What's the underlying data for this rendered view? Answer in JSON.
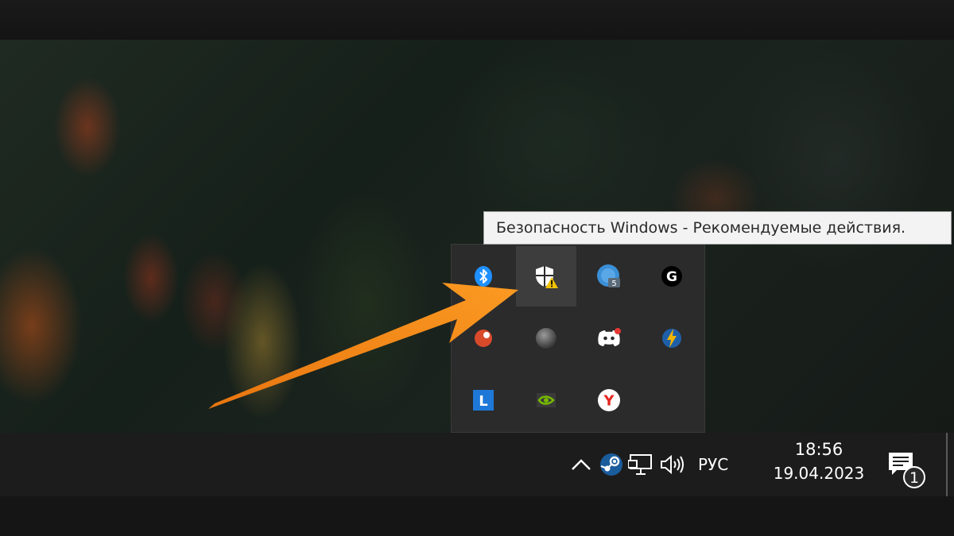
{
  "tooltip": {
    "text": "Безопасность Windows - Рекомендуемые действия."
  },
  "overflow_icons": [
    {
      "name": "bluetooth-icon",
      "color": "#1e90ff"
    },
    {
      "name": "windows-security-warning-icon",
      "color": "#f2c200",
      "hovered": true
    },
    {
      "name": "updater-icon",
      "badge": "5",
      "color": "#3b8fd6"
    },
    {
      "name": "logitech-g-icon",
      "label": "G",
      "color": "#ffffff"
    },
    {
      "name": "red-app-icon",
      "color": "#d94a2b"
    },
    {
      "name": "gray-orb-icon",
      "color": "#6d6d6d"
    },
    {
      "name": "discord-icon",
      "color": "#ffffff"
    },
    {
      "name": "lightning-app-icon",
      "color": "#f2b600"
    },
    {
      "name": "lingvo-l-icon",
      "label": "L",
      "color": "#1e78d8"
    },
    {
      "name": "nvidia-icon",
      "color": "#76b900"
    },
    {
      "name": "yandex-browser-icon",
      "label": "Y",
      "color": "#e52620"
    }
  ],
  "tray": {
    "language": "РУС",
    "icons": [
      "chevron-up-icon",
      "steam-icon",
      "network-icon",
      "volume-icon"
    ]
  },
  "clock": {
    "time": "18:56",
    "date": "19.04.2023"
  },
  "action_center": {
    "badge": "1"
  },
  "arrow": {
    "color": "#f08a16"
  }
}
